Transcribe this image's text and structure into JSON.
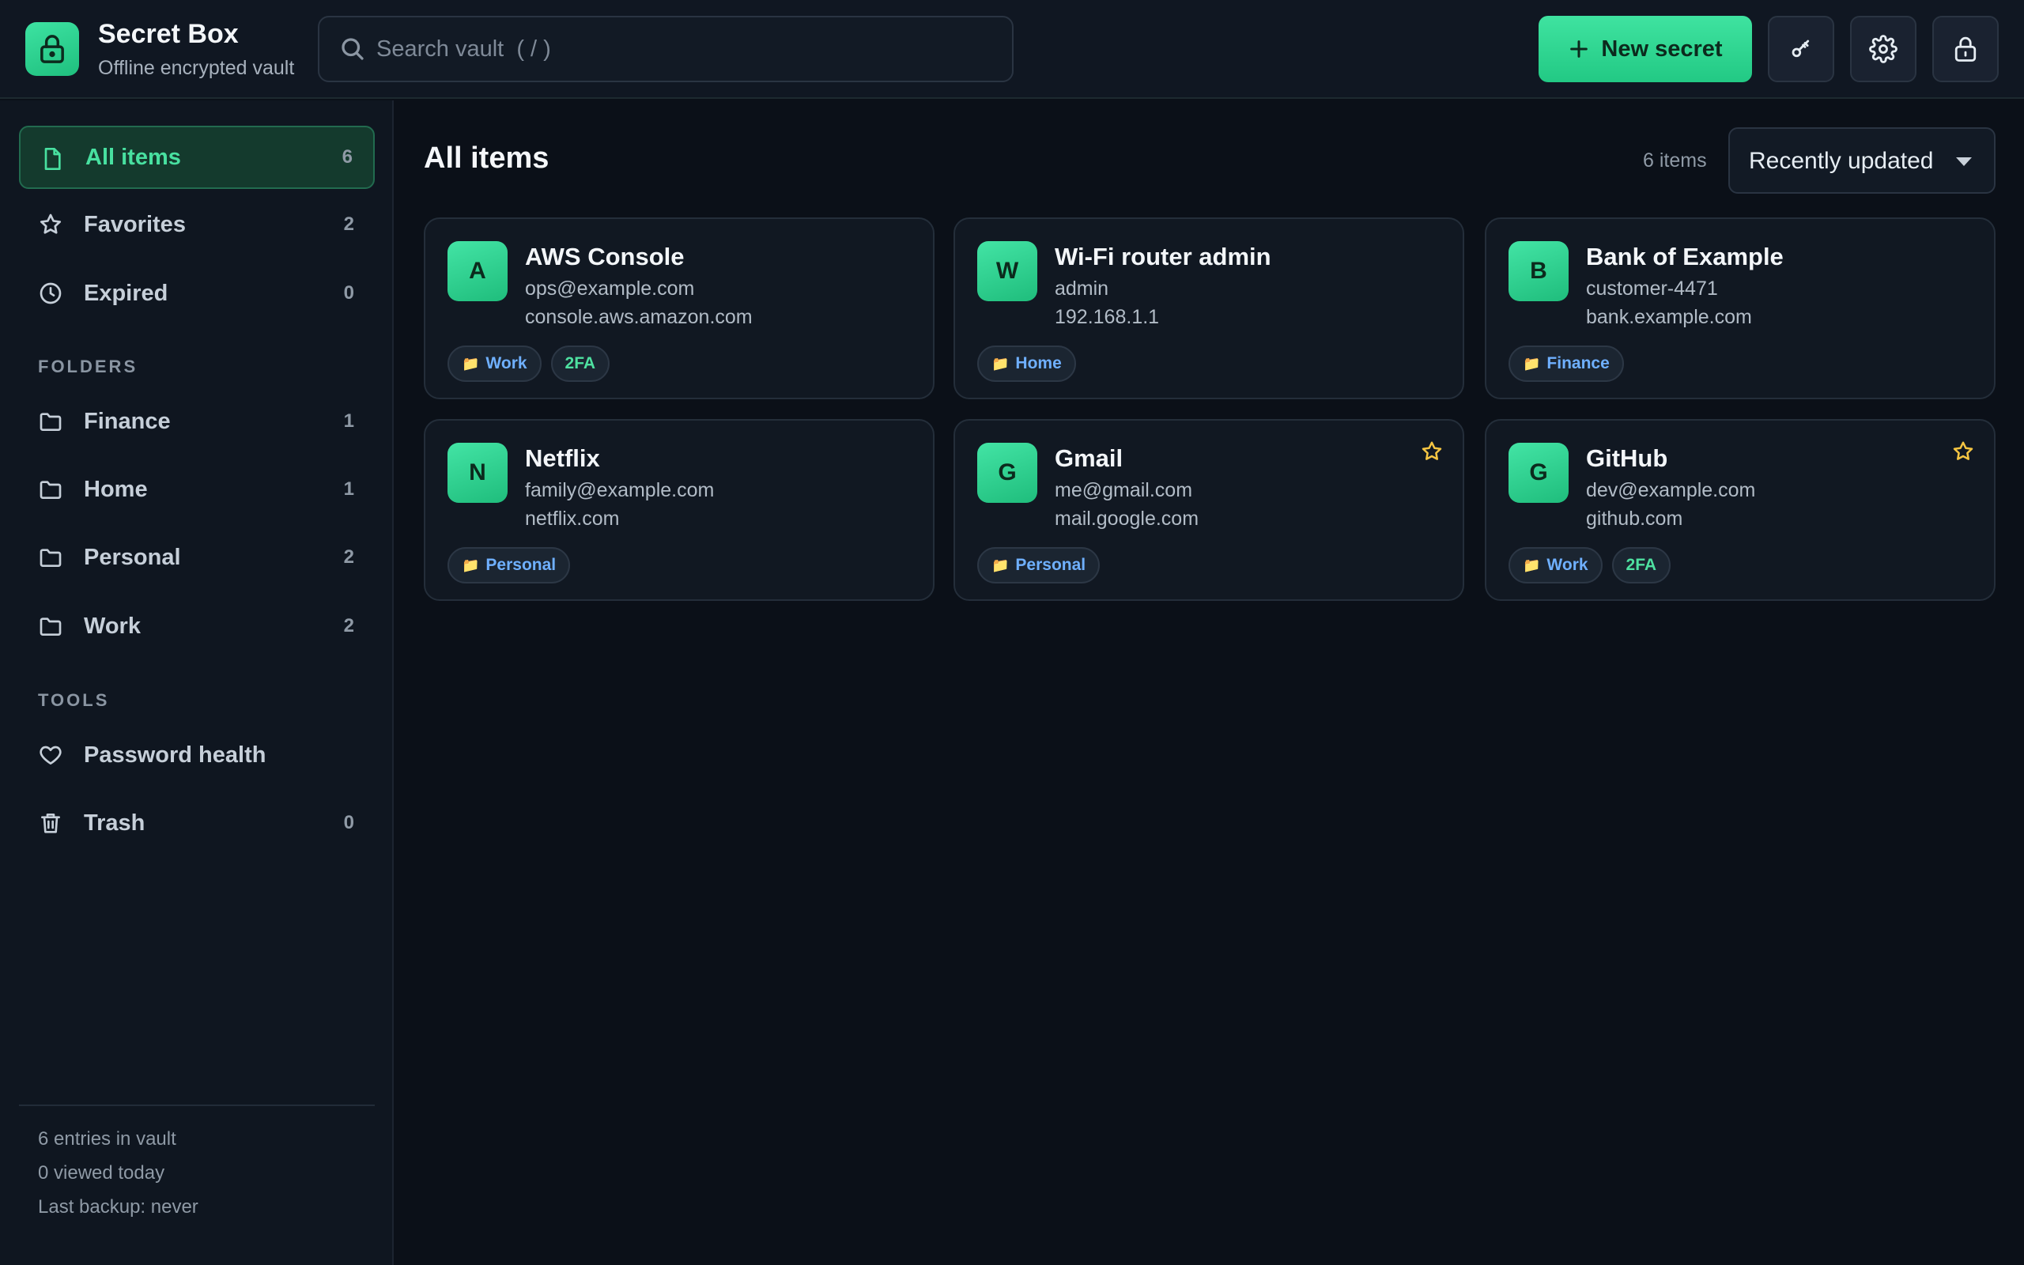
{
  "app": {
    "title": "Secret Box",
    "subtitle": "Offline encrypted vault"
  },
  "search": {
    "placeholder": "Search vault  ( / )",
    "value": ""
  },
  "toolbar": {
    "new_label": "New secret",
    "icons": [
      "key-icon",
      "gear-icon",
      "lock-icon"
    ]
  },
  "sidebar": {
    "items": [
      {
        "label": "All items",
        "count": "6",
        "icon": "file-icon",
        "active": true
      },
      {
        "label": "Favorites",
        "count": "2",
        "icon": "star-icon"
      },
      {
        "label": "Expired",
        "count": "0",
        "icon": "clock-icon"
      }
    ],
    "folders_label": "FOLDERS",
    "folders": [
      {
        "label": "Finance",
        "count": "1"
      },
      {
        "label": "Home",
        "count": "1"
      },
      {
        "label": "Personal",
        "count": "2"
      },
      {
        "label": "Work",
        "count": "2"
      }
    ],
    "tools_label": "TOOLS",
    "tools": [
      {
        "label": "Password health",
        "count": "",
        "icon": "heart-icon"
      },
      {
        "label": "Trash",
        "count": "0",
        "icon": "trash-icon"
      }
    ],
    "stats": [
      "6 entries in vault",
      "0 viewed today",
      "Last backup: never"
    ]
  },
  "main": {
    "title": "All items",
    "count_label": "6 items",
    "sort_value": "Recently updated",
    "cards": [
      {
        "initial": "A",
        "title": "AWS Console",
        "user": "ops@example.com",
        "url": "console.aws.amazon.com",
        "tags": [
          {
            "text": "Work",
            "kind": "folder"
          },
          {
            "text": "2FA",
            "kind": "flag"
          }
        ],
        "favorite": false
      },
      {
        "initial": "W",
        "title": "Wi-Fi router admin",
        "user": "admin",
        "url": "192.168.1.1",
        "tags": [
          {
            "text": "Home",
            "kind": "folder"
          }
        ],
        "favorite": false
      },
      {
        "initial": "B",
        "title": "Bank of Example",
        "user": "customer-4471",
        "url": "bank.example.com",
        "tags": [
          {
            "text": "Finance",
            "kind": "folder"
          }
        ],
        "favorite": false
      },
      {
        "initial": "N",
        "title": "Netflix",
        "user": "family@example.com",
        "url": "netflix.com",
        "tags": [
          {
            "text": "Personal",
            "kind": "folder"
          }
        ],
        "favorite": false
      },
      {
        "initial": "G",
        "title": "Gmail",
        "user": "me@gmail.com",
        "url": "mail.google.com",
        "tags": [
          {
            "text": "Personal",
            "kind": "folder"
          }
        ],
        "favorite": true
      },
      {
        "initial": "G",
        "title": "GitHub",
        "user": "dev@example.com",
        "url": "github.com",
        "tags": [
          {
            "text": "Work",
            "kind": "folder"
          },
          {
            "text": "2FA",
            "kind": "flag"
          }
        ],
        "favorite": true
      }
    ]
  },
  "colors": {
    "accent": "#3de3a2",
    "background": "#0b1018",
    "card": "#111822",
    "folder_tag": "#6fb0ff",
    "star": "#f5c542"
  }
}
